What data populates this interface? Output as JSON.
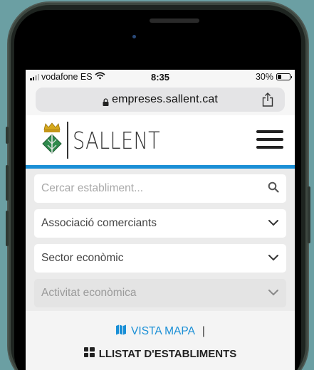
{
  "status_bar": {
    "carrier": "vodafone ES",
    "time": "8:35",
    "battery": "30%",
    "battery_level": 0.3
  },
  "browser": {
    "url": "empreses.sallent.cat"
  },
  "header": {
    "logo_text": "SALLENT"
  },
  "filters": {
    "search_placeholder": "Cercar establiment...",
    "association": "Associació comerciants",
    "sector": "Sector econòmic",
    "activity": "Activitat econòmica"
  },
  "view_toggle": {
    "map_label": "VISTA MAPA",
    "separator": "|",
    "list_label": "LLISTAT D'ESTABLIMENTS"
  },
  "colors": {
    "accent": "#1a8fd6",
    "background": "#6b9fa3"
  },
  "icons": [
    "wifi-icon",
    "battery-icon",
    "lock-icon",
    "share-icon",
    "coat-of-arms-icon",
    "hamburger-menu-icon",
    "search-icon",
    "chevron-down-icon",
    "map-icon",
    "grid-list-icon"
  ]
}
